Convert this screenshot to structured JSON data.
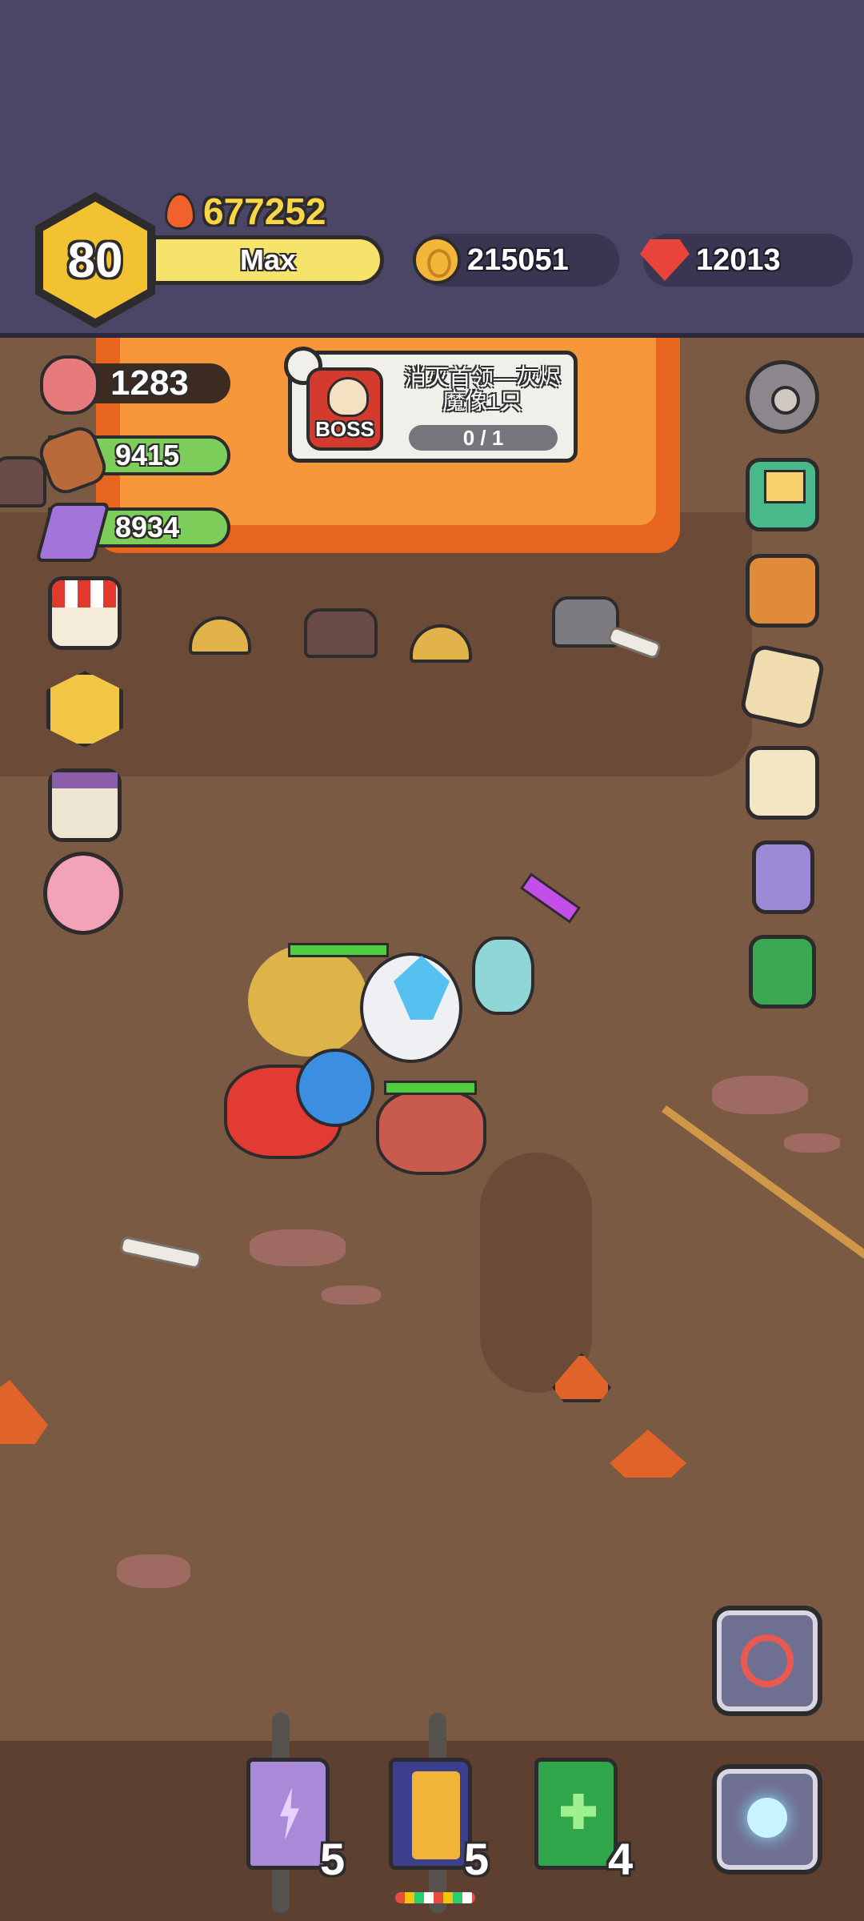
{
  "player": {
    "level": "80",
    "xp_label": "Max",
    "power": "677252"
  },
  "currency": {
    "gold": "215051",
    "gems": "12013"
  },
  "resources": {
    "meat": "1283",
    "wood": "9415",
    "ore": "8934"
  },
  "quest": {
    "boss_badge": "BOSS",
    "title": "消灭首领—灰烬魔像1只",
    "progress": "0 / 1"
  },
  "skills": [
    {
      "name": "lightning-book",
      "count": "5",
      "color": "#a98ad8"
    },
    {
      "name": "wing-book",
      "count": "5",
      "color": "#3c3f8c"
    },
    {
      "name": "heal-book",
      "count": "4",
      "color": "#2fa64a"
    }
  ],
  "colors": {
    "topbar": "#4b4566",
    "ground": "#7a5a43",
    "lava": "#f5973a",
    "gold_text": "#f9d548"
  }
}
